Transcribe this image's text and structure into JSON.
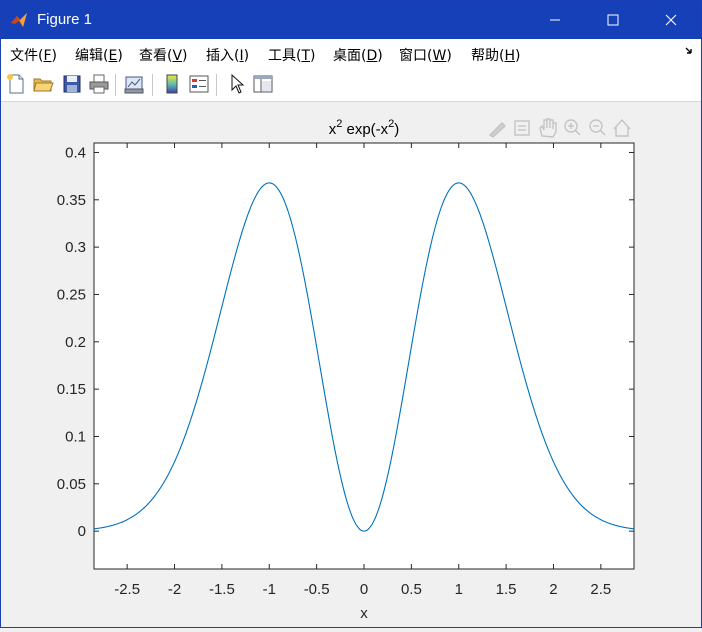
{
  "window": {
    "title": "Figure 1",
    "titlebar_color": "#1640b8"
  },
  "menu": {
    "items": [
      {
        "text": "文件(",
        "key": "F",
        "end": ")"
      },
      {
        "text": "编辑(",
        "key": "E",
        "end": ")"
      },
      {
        "text": "查看(",
        "key": "V",
        "end": ")"
      },
      {
        "text": "插入(",
        "key": "I",
        "end": ")"
      },
      {
        "text": "工具(",
        "key": "T",
        "end": ")"
      },
      {
        "text": "桌面(",
        "key": "D",
        "end": ")"
      },
      {
        "text": "窗口(",
        "key": "W",
        "end": ")"
      },
      {
        "text": "帮助(",
        "key": "H",
        "end": ")"
      }
    ]
  },
  "toolbar": {
    "icons": [
      "new-figure-icon",
      "open-file-icon",
      "save-icon",
      "print-icon",
      "link-plot-icon",
      "colorbar-icon",
      "legend-icon",
      "edit-plot-icon",
      "property-inspector-icon"
    ]
  },
  "axes_toolbar": {
    "icons": [
      "brush-icon",
      "data-tips-icon",
      "pan-icon",
      "zoom-in-icon",
      "zoom-out-icon",
      "home-icon"
    ]
  },
  "chart_data": {
    "type": "line",
    "title_base": "x",
    "title_sup1": "2",
    "title_mid": " exp(-x",
    "title_sup2": "2",
    "title_end": ")",
    "function": "x^2*exp(-x^2)",
    "xlabel": "x",
    "ylabel": "",
    "xlim": [
      -2.85,
      2.85
    ],
    "ylim": [
      -0.04,
      0.41
    ],
    "xticks": [
      -2.5,
      -2,
      -1.5,
      -1,
      -0.5,
      0,
      0.5,
      1,
      1.5,
      2,
      2.5
    ],
    "xtick_labels": [
      "-2.5",
      "-2",
      "-1.5",
      "-1",
      "-0.5",
      "0",
      "0.5",
      "1",
      "1.5",
      "2",
      "2.5"
    ],
    "yticks": [
      0,
      0.05,
      0.1,
      0.15,
      0.2,
      0.25,
      0.3,
      0.35,
      0.4
    ],
    "ytick_labels": [
      "0",
      "0.05",
      "0.1",
      "0.15",
      "0.2",
      "0.25",
      "0.3",
      "0.35",
      "0.4"
    ],
    "grid": false,
    "series": [
      {
        "color": "#0072bd",
        "x": [
          -2.85,
          -2.5,
          -2.25,
          -2.0,
          -1.75,
          -1.5,
          -1.25,
          -1.0,
          -0.75,
          -0.5,
          -0.25,
          0.0,
          0.25,
          0.5,
          0.75,
          1.0,
          1.25,
          1.5,
          1.75,
          2.0,
          2.25,
          2.5,
          2.85
        ],
        "y": [
          0.0025,
          0.0121,
          0.032,
          0.0733,
          0.1436,
          0.2371,
          0.3275,
          0.3679,
          0.3208,
          0.1947,
          0.0587,
          0.0,
          0.0587,
          0.1947,
          0.3208,
          0.3679,
          0.3275,
          0.2371,
          0.1436,
          0.0733,
          0.032,
          0.0121,
          0.0025
        ]
      }
    ]
  }
}
